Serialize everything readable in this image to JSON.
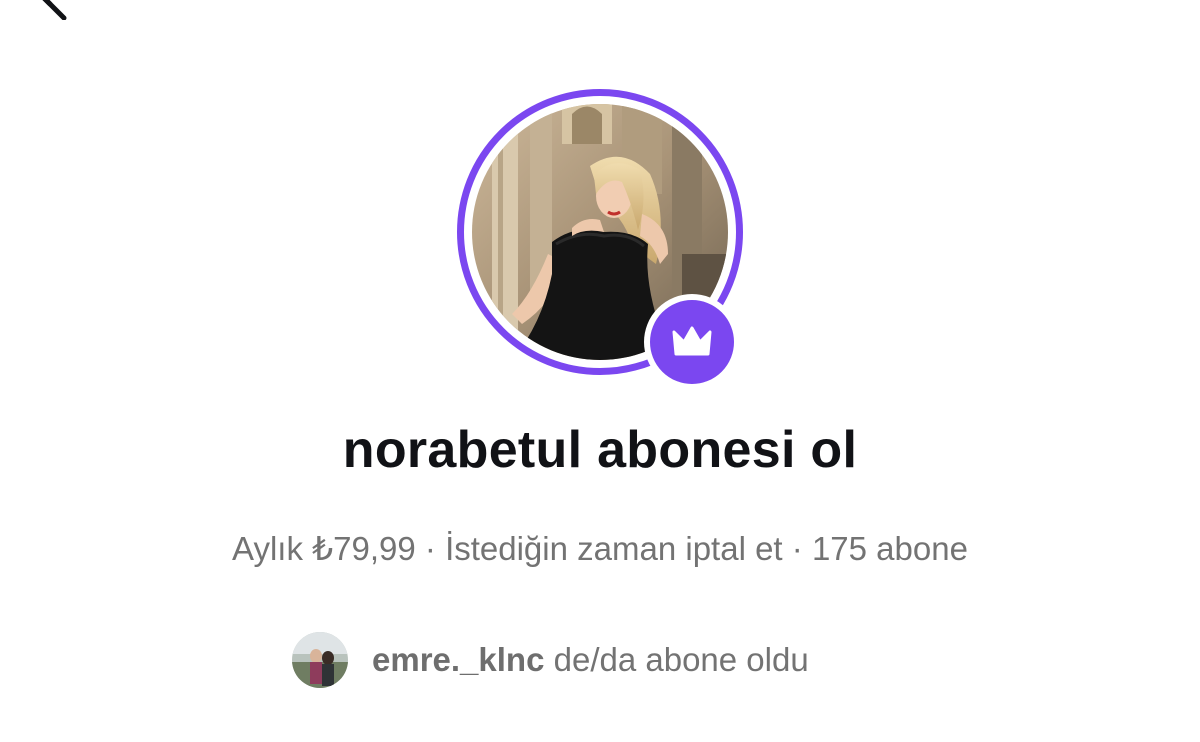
{
  "colors": {
    "accent": "#7B47F0",
    "title_text": "#111216",
    "secondary_text": "#737373"
  },
  "header": {
    "back_icon": "back-arrow-icon"
  },
  "profile": {
    "avatar_alt": "profile photo",
    "badge_icon": "crown-icon"
  },
  "title": "norabetul abonesi ol",
  "meta": {
    "price": "Aylık ₺79,99",
    "separator": "·",
    "cancel": "İstediğin zaman iptal et",
    "subscribers": "175 abone"
  },
  "recent_subscriber": {
    "username": "emre._klnc",
    "suffix": "de/da abone oldu"
  }
}
